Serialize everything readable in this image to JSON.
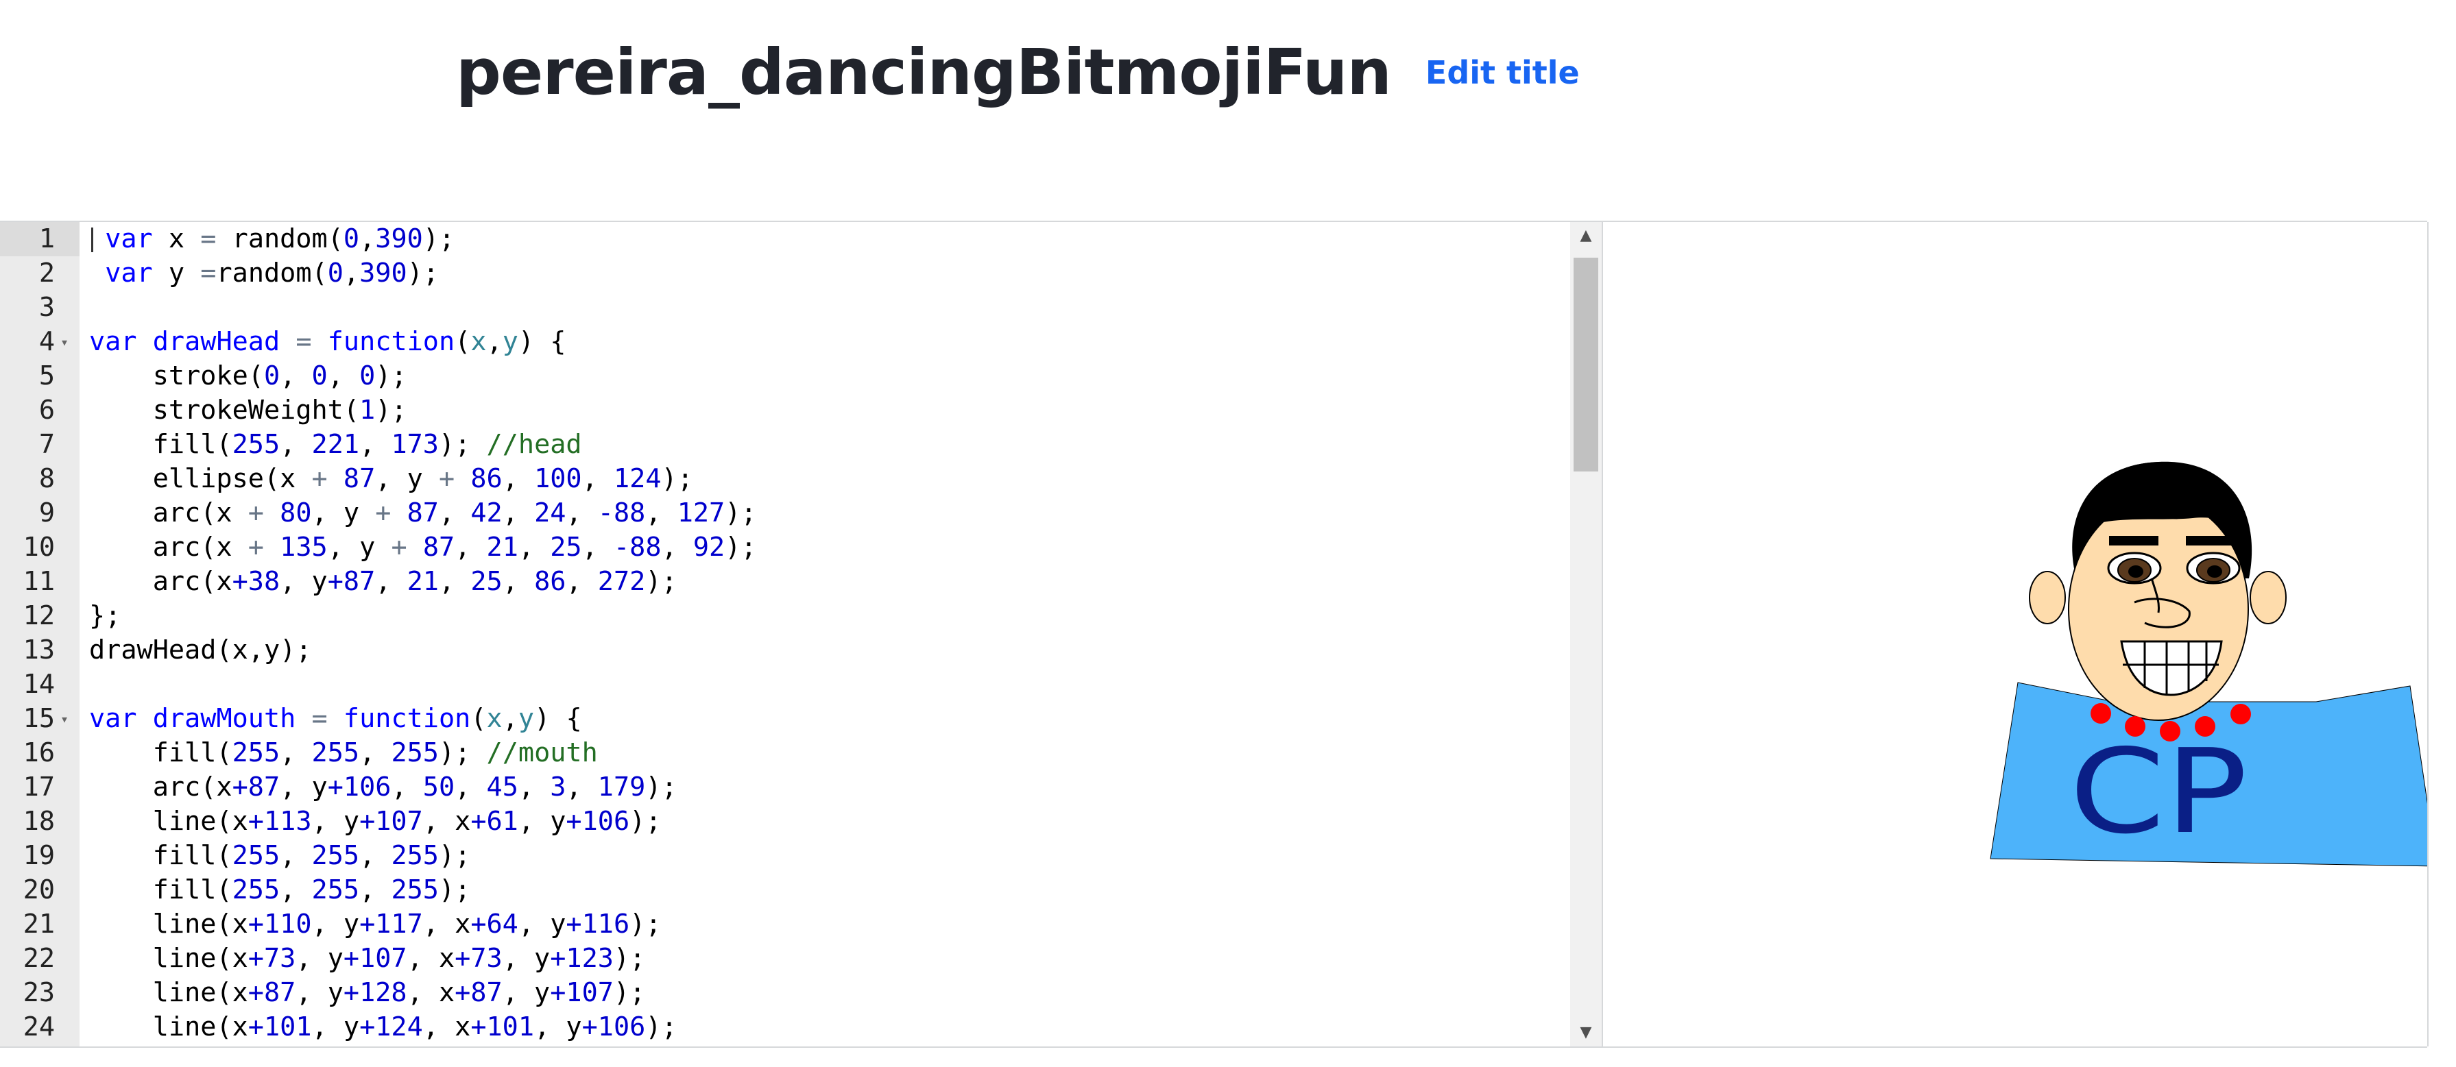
{
  "header": {
    "project_title": "pereira_dancingBitmojiFun",
    "edit_title_label": "Edit title"
  },
  "editor": {
    "lines": [
      {
        "n": "1",
        "tokens": [
          [
            "txt",
            " "
          ],
          [
            "kw",
            "var"
          ],
          [
            "txt",
            " x "
          ],
          [
            "op",
            "="
          ],
          [
            "txt",
            " random("
          ],
          [
            "num",
            "0"
          ],
          [
            "txt",
            ","
          ],
          [
            "num",
            "390"
          ],
          [
            "txt",
            ");"
          ]
        ]
      },
      {
        "n": "2",
        "tokens": [
          [
            "txt",
            " "
          ],
          [
            "kw",
            "var"
          ],
          [
            "txt",
            " y "
          ],
          [
            "op",
            "="
          ],
          [
            "txt",
            "random("
          ],
          [
            "num",
            "0"
          ],
          [
            "txt",
            ","
          ],
          [
            "num",
            "390"
          ],
          [
            "txt",
            ");"
          ]
        ]
      },
      {
        "n": "3",
        "tokens": []
      },
      {
        "n": "4",
        "fold": true,
        "tokens": [
          [
            "kw",
            "var"
          ],
          [
            "txt",
            " "
          ],
          [
            "kw",
            "drawHead"
          ],
          [
            "txt",
            " "
          ],
          [
            "op",
            "="
          ],
          [
            "txt",
            " "
          ],
          [
            "kw",
            "function"
          ],
          [
            "txt",
            "("
          ],
          [
            "var",
            "x"
          ],
          [
            "txt",
            ","
          ],
          [
            "var",
            "y"
          ],
          [
            "txt",
            ") {"
          ]
        ]
      },
      {
        "n": "5",
        "tokens": [
          [
            "txt",
            "    stroke("
          ],
          [
            "num",
            "0"
          ],
          [
            "txt",
            ", "
          ],
          [
            "num",
            "0"
          ],
          [
            "txt",
            ", "
          ],
          [
            "num",
            "0"
          ],
          [
            "txt",
            ");"
          ]
        ]
      },
      {
        "n": "6",
        "tokens": [
          [
            "txt",
            "    strokeWeight("
          ],
          [
            "num",
            "1"
          ],
          [
            "txt",
            ");"
          ]
        ]
      },
      {
        "n": "7",
        "tokens": [
          [
            "txt",
            "    fill("
          ],
          [
            "num",
            "255"
          ],
          [
            "txt",
            ", "
          ],
          [
            "num",
            "221"
          ],
          [
            "txt",
            ", "
          ],
          [
            "num",
            "173"
          ],
          [
            "txt",
            "); "
          ],
          [
            "com",
            "//head"
          ]
        ]
      },
      {
        "n": "8",
        "tokens": [
          [
            "txt",
            "    ellipse(x "
          ],
          [
            "op",
            "+"
          ],
          [
            "txt",
            " "
          ],
          [
            "num",
            "87"
          ],
          [
            "txt",
            ", y "
          ],
          [
            "op",
            "+"
          ],
          [
            "txt",
            " "
          ],
          [
            "num",
            "86"
          ],
          [
            "txt",
            ", "
          ],
          [
            "num",
            "100"
          ],
          [
            "txt",
            ", "
          ],
          [
            "num",
            "124"
          ],
          [
            "txt",
            ");"
          ]
        ]
      },
      {
        "n": "9",
        "tokens": [
          [
            "txt",
            "    arc(x "
          ],
          [
            "op",
            "+"
          ],
          [
            "txt",
            " "
          ],
          [
            "num",
            "80"
          ],
          [
            "txt",
            ", y "
          ],
          [
            "op",
            "+"
          ],
          [
            "txt",
            " "
          ],
          [
            "num",
            "87"
          ],
          [
            "txt",
            ", "
          ],
          [
            "num",
            "42"
          ],
          [
            "txt",
            ", "
          ],
          [
            "num",
            "24"
          ],
          [
            "txt",
            ", "
          ],
          [
            "num",
            "-88"
          ],
          [
            "txt",
            ", "
          ],
          [
            "num",
            "127"
          ],
          [
            "txt",
            ");"
          ]
        ]
      },
      {
        "n": "10",
        "tokens": [
          [
            "txt",
            "    arc(x "
          ],
          [
            "op",
            "+"
          ],
          [
            "txt",
            " "
          ],
          [
            "num",
            "135"
          ],
          [
            "txt",
            ", y "
          ],
          [
            "op",
            "+"
          ],
          [
            "txt",
            " "
          ],
          [
            "num",
            "87"
          ],
          [
            "txt",
            ", "
          ],
          [
            "num",
            "21"
          ],
          [
            "txt",
            ", "
          ],
          [
            "num",
            "25"
          ],
          [
            "txt",
            ", "
          ],
          [
            "num",
            "-88"
          ],
          [
            "txt",
            ", "
          ],
          [
            "num",
            "92"
          ],
          [
            "txt",
            ");"
          ]
        ]
      },
      {
        "n": "11",
        "tokens": [
          [
            "txt",
            "    arc(x"
          ],
          [
            "num",
            "+38"
          ],
          [
            "txt",
            ", y"
          ],
          [
            "num",
            "+87"
          ],
          [
            "txt",
            ", "
          ],
          [
            "num",
            "21"
          ],
          [
            "txt",
            ", "
          ],
          [
            "num",
            "25"
          ],
          [
            "txt",
            ", "
          ],
          [
            "num",
            "86"
          ],
          [
            "txt",
            ", "
          ],
          [
            "num",
            "272"
          ],
          [
            "txt",
            ");"
          ]
        ]
      },
      {
        "n": "12",
        "tokens": [
          [
            "txt",
            "};"
          ]
        ]
      },
      {
        "n": "13",
        "tokens": [
          [
            "txt",
            "drawHead(x,y);"
          ]
        ]
      },
      {
        "n": "14",
        "tokens": []
      },
      {
        "n": "15",
        "fold": true,
        "tokens": [
          [
            "kw",
            "var"
          ],
          [
            "txt",
            " "
          ],
          [
            "kw",
            "drawMouth"
          ],
          [
            "txt",
            " "
          ],
          [
            "op",
            "="
          ],
          [
            "txt",
            " "
          ],
          [
            "kw",
            "function"
          ],
          [
            "txt",
            "("
          ],
          [
            "var",
            "x"
          ],
          [
            "txt",
            ","
          ],
          [
            "var",
            "y"
          ],
          [
            "txt",
            ") {"
          ]
        ]
      },
      {
        "n": "16",
        "tokens": [
          [
            "txt",
            "    fill("
          ],
          [
            "num",
            "255"
          ],
          [
            "txt",
            ", "
          ],
          [
            "num",
            "255"
          ],
          [
            "txt",
            ", "
          ],
          [
            "num",
            "255"
          ],
          [
            "txt",
            "); "
          ],
          [
            "com",
            "//mouth"
          ]
        ]
      },
      {
        "n": "17",
        "tokens": [
          [
            "txt",
            "    arc(x"
          ],
          [
            "num",
            "+87"
          ],
          [
            "txt",
            ", y"
          ],
          [
            "num",
            "+106"
          ],
          [
            "txt",
            ", "
          ],
          [
            "num",
            "50"
          ],
          [
            "txt",
            ", "
          ],
          [
            "num",
            "45"
          ],
          [
            "txt",
            ", "
          ],
          [
            "num",
            "3"
          ],
          [
            "txt",
            ", "
          ],
          [
            "num",
            "179"
          ],
          [
            "txt",
            ");"
          ]
        ]
      },
      {
        "n": "18",
        "tokens": [
          [
            "txt",
            "    line(x"
          ],
          [
            "num",
            "+113"
          ],
          [
            "txt",
            ", y"
          ],
          [
            "num",
            "+107"
          ],
          [
            "txt",
            ", x"
          ],
          [
            "num",
            "+61"
          ],
          [
            "txt",
            ", y"
          ],
          [
            "num",
            "+106"
          ],
          [
            "txt",
            ");"
          ]
        ]
      },
      {
        "n": "19",
        "tokens": [
          [
            "txt",
            "    fill("
          ],
          [
            "num",
            "255"
          ],
          [
            "txt",
            ", "
          ],
          [
            "num",
            "255"
          ],
          [
            "txt",
            ", "
          ],
          [
            "num",
            "255"
          ],
          [
            "txt",
            ");"
          ]
        ]
      },
      {
        "n": "20",
        "tokens": [
          [
            "txt",
            "    fill("
          ],
          [
            "num",
            "255"
          ],
          [
            "txt",
            ", "
          ],
          [
            "num",
            "255"
          ],
          [
            "txt",
            ", "
          ],
          [
            "num",
            "255"
          ],
          [
            "txt",
            ");"
          ]
        ]
      },
      {
        "n": "21",
        "tokens": [
          [
            "txt",
            "    line(x"
          ],
          [
            "num",
            "+110"
          ],
          [
            "txt",
            ", y"
          ],
          [
            "num",
            "+117"
          ],
          [
            "txt",
            ", x"
          ],
          [
            "num",
            "+64"
          ],
          [
            "txt",
            ", y"
          ],
          [
            "num",
            "+116"
          ],
          [
            "txt",
            ");"
          ]
        ]
      },
      {
        "n": "22",
        "tokens": [
          [
            "txt",
            "    line(x"
          ],
          [
            "num",
            "+73"
          ],
          [
            "txt",
            ", y"
          ],
          [
            "num",
            "+107"
          ],
          [
            "txt",
            ", x"
          ],
          [
            "num",
            "+73"
          ],
          [
            "txt",
            ", y"
          ],
          [
            "num",
            "+123"
          ],
          [
            "txt",
            ");"
          ]
        ]
      },
      {
        "n": "23",
        "tokens": [
          [
            "txt",
            "    line(x"
          ],
          [
            "num",
            "+87"
          ],
          [
            "txt",
            ", y"
          ],
          [
            "num",
            "+128"
          ],
          [
            "txt",
            ", x"
          ],
          [
            "num",
            "+87"
          ],
          [
            "txt",
            ", y"
          ],
          [
            "num",
            "+107"
          ],
          [
            "txt",
            ");"
          ]
        ]
      },
      {
        "n": "24",
        "tokens": [
          [
            "txt",
            "    line(x"
          ],
          [
            "num",
            "+101"
          ],
          [
            "txt",
            ", y"
          ],
          [
            "num",
            "+124"
          ],
          [
            "txt",
            ", x"
          ],
          [
            "num",
            "+101"
          ],
          [
            "txt",
            ", y"
          ],
          [
            "num",
            "+106"
          ],
          [
            "txt",
            ");"
          ]
        ]
      }
    ],
    "scroll_up_icon": "triangle-up-icon",
    "scroll_down_icon": "triangle-down-icon"
  },
  "output": {
    "shirt_text": "CP",
    "colors": {
      "skin": "#fedcac",
      "hair": "#000000",
      "shirt": "#4db3fa",
      "shirt_text": "#0a1f86",
      "dots": "#ff0000",
      "teeth": "#ffffff"
    }
  }
}
